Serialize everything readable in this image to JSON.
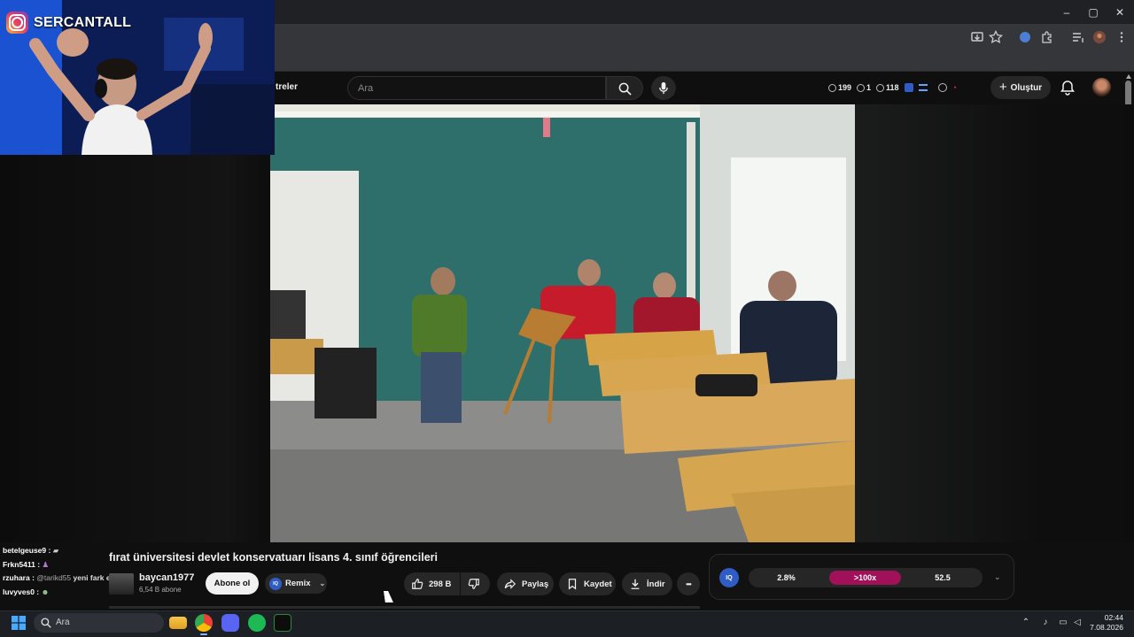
{
  "browser": {
    "window_controls": {
      "minimize": "–",
      "maximize": "▢",
      "close": "✕"
    }
  },
  "youtube": {
    "filters_label": "treler",
    "search": {
      "placeholder": "Ara"
    },
    "header_stats": {
      "s1": "199",
      "s2": "1",
      "s3": "118"
    },
    "create_label": "Oluştur"
  },
  "webcam": {
    "streamer_name": "SERCANTALL"
  },
  "chat": [
    {
      "user": "betelgeuse9 :",
      "message": "",
      "mention": ""
    },
    {
      "user": "Frkn5411 :",
      "message": "",
      "mention": ""
    },
    {
      "user": "rzuhara :",
      "mention": "@tarikd55",
      "message": "yeni fark ettim aq"
    },
    {
      "user": "luvyves0 :",
      "message": "",
      "mention": ""
    }
  ],
  "video": {
    "title": "fırat üniversitesi devlet konservatuarı lisans 4. sınıf öğrencileri",
    "channel_name": "baycan1977",
    "subscribers": "6,54 B abone",
    "subscribe_label": "Abone ol",
    "remix_label": "Remix",
    "iq_short": "IQ",
    "likes": "298 B",
    "share_label": "Paylaş",
    "save_label": "Kaydet",
    "download_label": "İndir",
    "more_label": "•••"
  },
  "iq_widget": {
    "badge": "IQ",
    "stat1": "2.8%",
    "stat2": ">100x",
    "stat3": "52.5",
    "highlight_color": "#a0115a"
  },
  "taskbar": {
    "search_placeholder": "Ara",
    "time": "02:44",
    "date": "7.08.2026"
  }
}
